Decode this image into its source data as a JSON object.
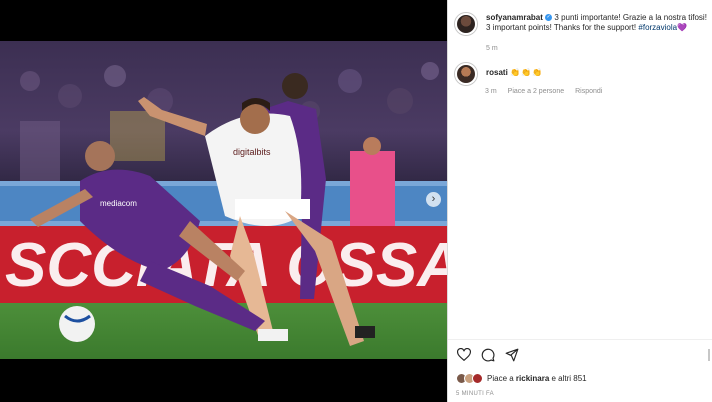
{
  "post": {
    "username": "sofyanamrabat",
    "caption_text": "3 punti importante! Grazie a la nostra tifosi! 3 important points! Thanks for the support!",
    "hashtag": "#forzaviola",
    "heart": "💜",
    "time_ago": "5 m"
  },
  "comment": {
    "username": "rosati",
    "text": "👏👏👏",
    "time_ago": "3 m",
    "likes_label": "Piace a 2 persone",
    "reply_label": "Rispondi"
  },
  "likes": {
    "text_prefix": "Piace a ",
    "user": "rickinara",
    "text_suffix": " e altri 851"
  },
  "timestamp": "5 MINUTI FA",
  "photo": {
    "sponsor": "digitalbits",
    "banner": "SCCIATA OSSA",
    "kit_text": "mediacom"
  },
  "icons": {
    "heart": "heart-icon",
    "comment": "comment-icon",
    "share": "share-icon",
    "next": "chevron-right-icon"
  },
  "colors": {
    "fiorentina_purple": "#5b2b86",
    "banner_red": "#c8202d",
    "link": "#00376b"
  },
  "carousel": {
    "slides": 5,
    "active": 3
  }
}
